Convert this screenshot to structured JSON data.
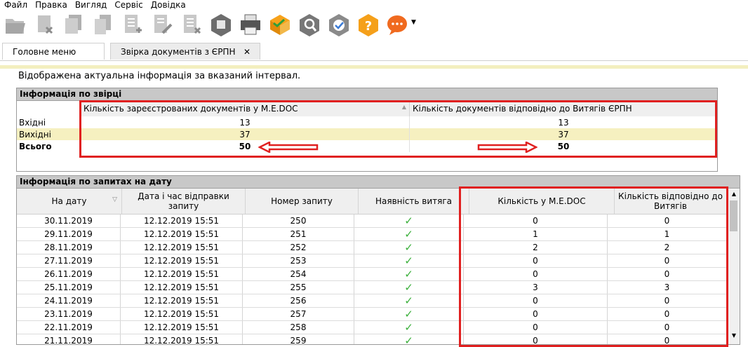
{
  "menu": [
    "Файл",
    "Правка",
    "Вигляд",
    "Сервіс",
    "Довідка"
  ],
  "toolbar_icons": [
    "open-icon",
    "delete-icon",
    "copy-icon",
    "duplicate-icon",
    "add-doc-icon",
    "edit-doc-icon",
    "remove-doc-icon",
    "archive-icon",
    "print-icon",
    "send-icon",
    "search-icon",
    "verify-icon",
    "help-icon",
    "chat-icon"
  ],
  "tabs": [
    {
      "label": "Головне меню"
    },
    {
      "label": "Звірка документів з ЄРПН",
      "close": "✕"
    }
  ],
  "info_text": "Відображена актуальна інформація за вказаний інтервал.",
  "summary": {
    "title": "Інформація по звірці",
    "col1": "Кількість зареєстрованих документів у M.E.DOC",
    "col2": "Кількість документів відповідно до Витягів ЄРПН",
    "rows": [
      {
        "label": "Вхідні",
        "a": "13",
        "b": "13"
      },
      {
        "label": "Вихідні",
        "a": "37",
        "b": "37"
      },
      {
        "label": "Всього",
        "a": "50",
        "b": "50"
      }
    ]
  },
  "requests": {
    "title": "Інформація по запитах на дату",
    "headers": [
      "На дату",
      "Дата і час відправки запиту",
      "Номер запиту",
      "Наявність витяга",
      "Кількість у M.E.DOC",
      "Кількість відповідно до Витягів"
    ],
    "rows": [
      [
        "30.11.2019",
        "12.12.2019 15:51",
        "250",
        "✓",
        "0",
        "0"
      ],
      [
        "29.11.2019",
        "12.12.2019 15:51",
        "251",
        "✓",
        "1",
        "1"
      ],
      [
        "28.11.2019",
        "12.12.2019 15:51",
        "252",
        "✓",
        "2",
        "2"
      ],
      [
        "27.11.2019",
        "12.12.2019 15:51",
        "253",
        "✓",
        "0",
        "0"
      ],
      [
        "26.11.2019",
        "12.12.2019 15:51",
        "254",
        "✓",
        "0",
        "0"
      ],
      [
        "25.11.2019",
        "12.12.2019 15:51",
        "255",
        "✓",
        "3",
        "3"
      ],
      [
        "24.11.2019",
        "12.12.2019 15:51",
        "256",
        "✓",
        "0",
        "0"
      ],
      [
        "23.11.2019",
        "12.12.2019 15:51",
        "257",
        "✓",
        "0",
        "0"
      ],
      [
        "22.11.2019",
        "12.12.2019 15:51",
        "258",
        "✓",
        "0",
        "0"
      ],
      [
        "21.11.2019",
        "12.12.2019 15:51",
        "259",
        "✓",
        "0",
        "0"
      ]
    ]
  },
  "colors": {
    "highlight_row": "#f6f0c0",
    "annotation": "#e02020",
    "check": "#3bb03b"
  }
}
